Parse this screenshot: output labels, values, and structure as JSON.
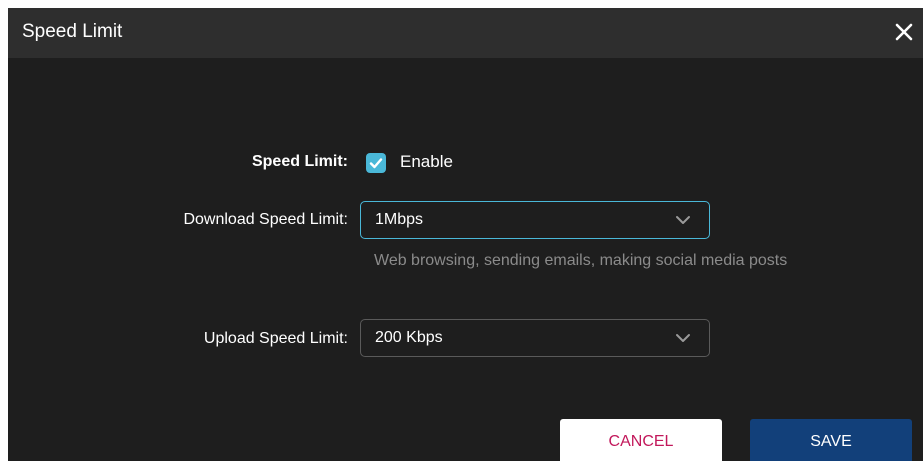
{
  "dialog": {
    "title": "Speed Limit",
    "close_icon": "close-icon",
    "colors": {
      "title_bar": "#2e2e2e",
      "background": "#1e1e1e",
      "accent": "#4ab8d8",
      "save_button": "#12407a",
      "cancel_text": "#c2185b"
    }
  },
  "form": {
    "speed_limit": {
      "label": "Speed Limit:",
      "checkbox_label": "Enable",
      "checked": true,
      "check_icon": "checkmark-icon"
    },
    "download": {
      "label": "Download Speed Limit:",
      "value": "1Mbps",
      "chevron_icon": "chevron-down-icon",
      "hint": "Web browsing, sending emails, making social media posts"
    },
    "upload": {
      "label": "Upload Speed Limit:",
      "value": "200 Kbps",
      "chevron_icon": "chevron-down-icon"
    }
  },
  "footer": {
    "cancel_label": "CANCEL",
    "save_label": "SAVE"
  }
}
